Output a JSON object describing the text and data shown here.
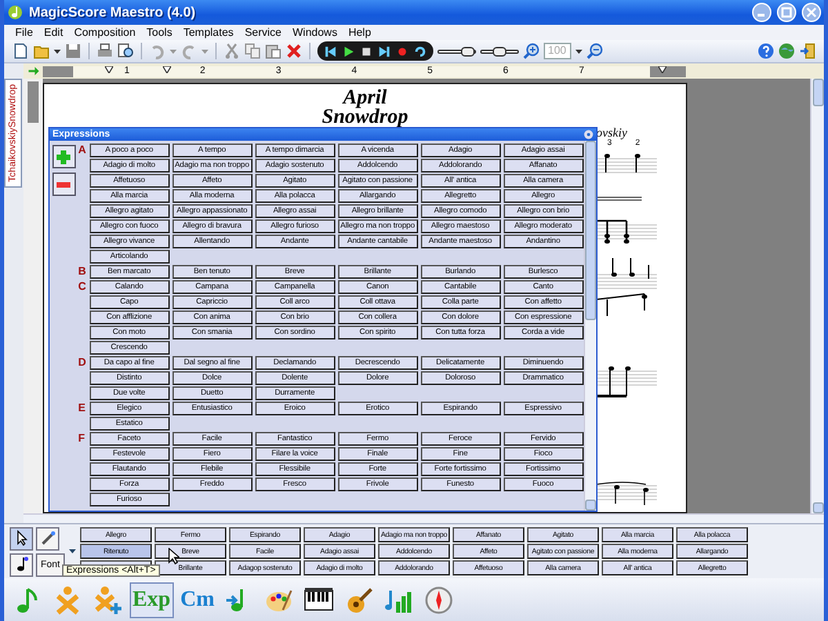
{
  "window": {
    "title": "MagicScore Maestro (4.0)"
  },
  "menu": [
    "File",
    "Edit",
    "Composition",
    "Tools",
    "Templates",
    "Service",
    "Windows",
    "Help"
  ],
  "toolbar": {
    "sliders": [
      {
        "level": 0.8
      },
      {
        "level": 0.5
      }
    ],
    "zoom": {
      "value": "100",
      "disabled": true
    }
  },
  "document_tab": {
    "label": "TchaikovskiySnowdrop",
    "selected": true
  },
  "ruler": [
    "1",
    "2",
    "3",
    "4",
    "5",
    "6",
    "7"
  ],
  "score": {
    "title": "April",
    "subtitle": "Snowdrop",
    "composer": "ovskiy",
    "measure_numbers": [
      "3",
      "2"
    ]
  },
  "expressions_panel": {
    "title": "Expressions",
    "sections": [
      {
        "letter": "A",
        "items": [
          "A poco a poco",
          "A tempo",
          "A tempo dimarcia",
          "A vicenda",
          "Adagio",
          "Adagio assai",
          "Adagio di molto",
          "Adagio ma non troppo",
          "Adagio sostenuto",
          "Addolcendo",
          "Addolorando",
          "Affanato",
          "Affetuoso",
          "Affeto",
          "Agitato",
          "Agitato con passione",
          "All' antica",
          "Alla camera",
          "Alla marcia",
          "Alla moderna",
          "Alla polacca",
          "Allargando",
          "Allegretto",
          "Allegro",
          "Allegro agitato",
          "Allegro appassionato",
          "Allegro assai",
          "Allegro brillante",
          "Allegro comodo",
          "Allegro con brio",
          "Allegro con fuoco",
          "Allegro di bravura",
          "Allegro furioso",
          "Allegro ma non troppo",
          "Allegro maestoso",
          "Allegro moderato",
          "Allegro vivance",
          "Allentando",
          "Andante",
          "Andante cantabile",
          "Andante maestoso",
          "Andantino",
          "Articolando"
        ]
      },
      {
        "letter": "B",
        "items": [
          "Ben marcato",
          "Ben tenuto",
          "Breve",
          "Brillante",
          "Burlando",
          "Burlesco"
        ]
      },
      {
        "letter": "C",
        "items": [
          "Calando",
          "Campana",
          "Campanella",
          "Canon",
          "Cantabile",
          "Canto",
          "Capo",
          "Capriccio",
          "Coll arco",
          "Coll ottava",
          "Colla parte",
          "Con affetto",
          "Con afflizione",
          "Con anima",
          "Con brio",
          "Con collera",
          "Con dolore",
          "Con espressione",
          "Con moto",
          "Con smania",
          "Con sordino",
          "Con spirito",
          "Con tutta forza",
          "Corda a vide",
          "Crescendo"
        ]
      },
      {
        "letter": "D",
        "items": [
          "Da capo al fine",
          "Dal segno al fine",
          "Declamando",
          "Decrescendo",
          "Delicatamente",
          "Diminuendo",
          "Distinto",
          "Dolce",
          "Dolente",
          "Dolore",
          "Doloroso",
          "Drammatico",
          "Due volte",
          "Duetto",
          "Durramente"
        ]
      },
      {
        "letter": "E",
        "items": [
          "Elegico",
          "Entusiastico",
          "Eroico",
          "Erotico",
          "Espirando",
          "Espressivo",
          "Estatico"
        ]
      },
      {
        "letter": "F",
        "items": [
          "Faceto",
          "Facile",
          "Fantastico",
          "Fermo",
          "Feroce",
          "Fervido",
          "Festevole",
          "Fiero",
          "Filare la voice",
          "Finale",
          "Fine",
          "Fioco",
          "Flautando",
          "Flebile",
          "Flessibile",
          "Forte",
          "Forte fortissimo",
          "Fortissimo",
          "Forza",
          "Freddo",
          "Fresco",
          "Frivole",
          "Funesto",
          "Fuoco",
          "Furioso"
        ]
      }
    ]
  },
  "quick_panel": {
    "tools": [
      {
        "kind": "icon",
        "selected": true
      },
      {
        "kind": "icon",
        "selected": false
      },
      {
        "kind": "icon",
        "selected": false
      },
      {
        "kind": "text",
        "label": "Font",
        "selected": false
      }
    ],
    "rows": [
      [
        {
          "label": "Allegro",
          "selected": false
        },
        {
          "label": "Fermo",
          "selected": false
        },
        {
          "label": "Espirando",
          "selected": false
        },
        {
          "label": "Adagio",
          "selected": false
        },
        {
          "label": "Adagio ma non troppo",
          "selected": false
        },
        {
          "label": "Affanato",
          "selected": false
        },
        {
          "label": "Agitato",
          "selected": false
        },
        {
          "label": "Alla marcia",
          "selected": false
        },
        {
          "label": "Alla polacca",
          "selected": false
        }
      ],
      [
        {
          "label": "Ritenuto",
          "selected": true
        },
        {
          "label": "Breve",
          "selected": false
        },
        {
          "label": "Facile",
          "selected": false
        },
        {
          "label": "Adagio assai",
          "selected": false
        },
        {
          "label": "Addolcendo",
          "selected": false
        },
        {
          "label": "Affeto",
          "selected": false
        },
        {
          "label": "Agitato con passione",
          "selected": false
        },
        {
          "label": "Alla moderna",
          "selected": false
        },
        {
          "label": "Allargando",
          "selected": false
        }
      ],
      [
        {
          "selected": false
        },
        {
          "label": "Brillante",
          "selected": false
        },
        {
          "label": "Adagop sostenuto",
          "selected": false
        },
        {
          "label": "Adagio di molto",
          "selected": false
        },
        {
          "label": "Addolorando",
          "selected": false
        },
        {
          "label": "Affetuoso",
          "selected": false
        },
        {
          "label": "Alla camera",
          "selected": false
        },
        {
          "label": "All' antica",
          "selected": false
        },
        {
          "label": "Allegretto",
          "selected": false
        }
      ]
    ],
    "tooltip": "Expressions <Alt+T>"
  },
  "palette": [
    {
      "kind": "icon",
      "selected": false
    },
    {
      "kind": "icon",
      "selected": false
    },
    {
      "kind": "icon",
      "selected": false
    },
    {
      "kind": "text",
      "label": "Exp",
      "selected": true
    },
    {
      "kind": "text",
      "label": "Cm",
      "selected": false
    },
    {
      "kind": "icon",
      "selected": false
    },
    {
      "kind": "icon",
      "selected": false
    },
    {
      "kind": "icon",
      "selected": false
    },
    {
      "kind": "icon",
      "selected": false
    },
    {
      "kind": "icon",
      "selected": false
    },
    {
      "kind": "icon",
      "selected": false
    }
  ]
}
